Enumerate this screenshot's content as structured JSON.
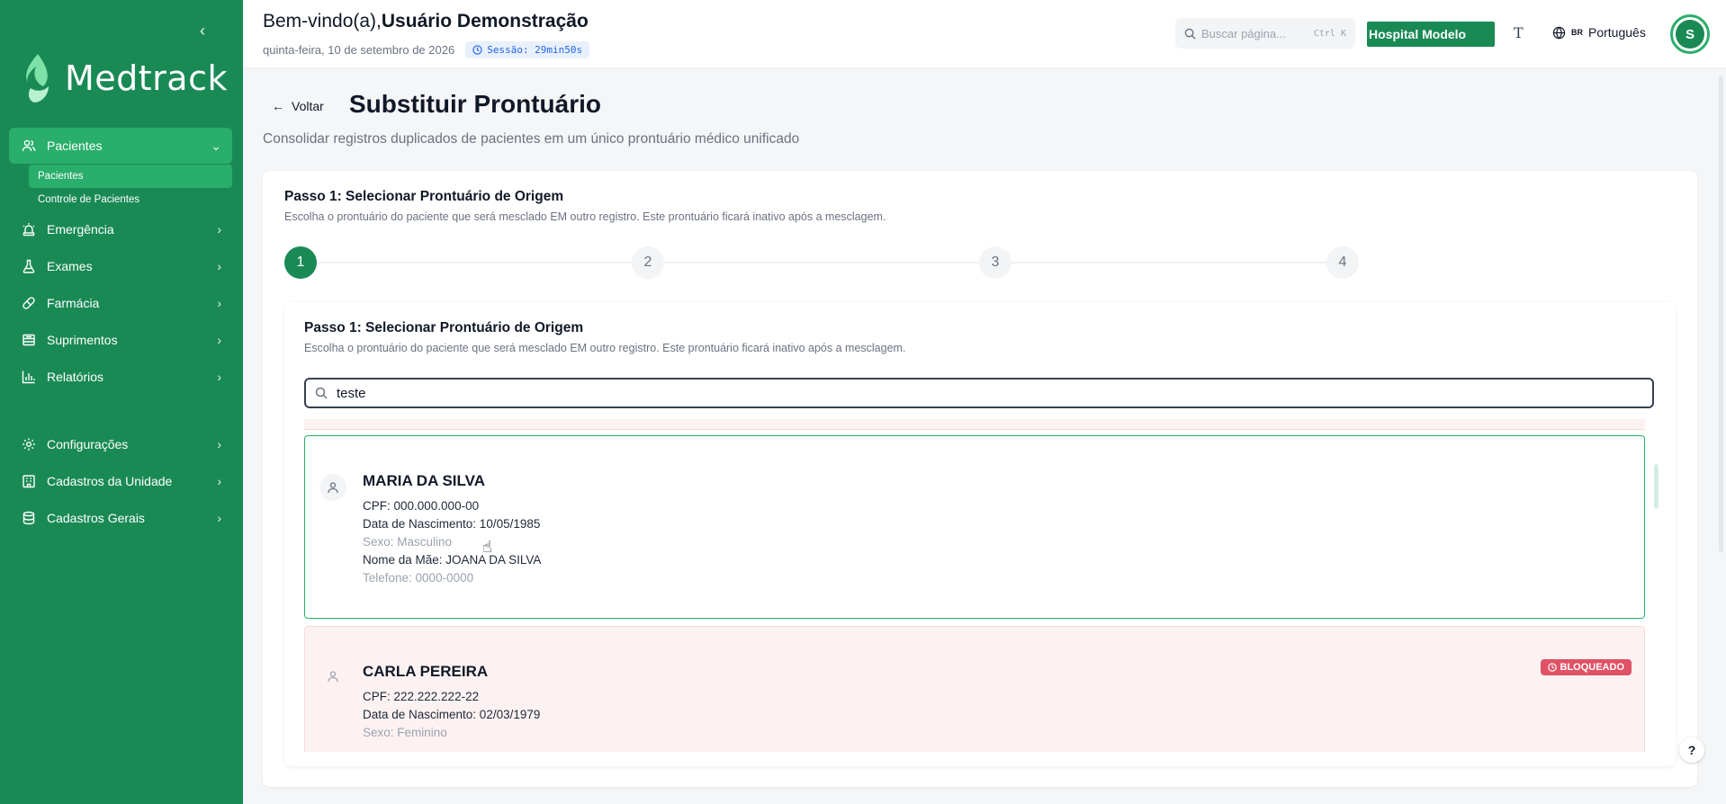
{
  "app": {
    "name": "Medtrack",
    "collapse_icon": "chevron-left-icon"
  },
  "sidebar": {
    "items": [
      {
        "label": "Pacientes",
        "icon": "users-icon",
        "active": true,
        "expanded": true,
        "children": [
          {
            "label": "Pacientes",
            "active": true
          },
          {
            "label": "Controle de Pacientes",
            "active": false
          }
        ]
      },
      {
        "label": "Emergência",
        "icon": "siren-icon"
      },
      {
        "label": "Exames",
        "icon": "flask-icon"
      },
      {
        "label": "Farmácia",
        "icon": "pill-icon"
      },
      {
        "label": "Suprimentos",
        "icon": "box-icon"
      },
      {
        "label": "Relatórios",
        "icon": "bar-chart-icon"
      }
    ],
    "bottom_items": [
      {
        "label": "Configurações",
        "icon": "gear-icon"
      },
      {
        "label": "Cadastros da Unidade",
        "icon": "building-icon"
      },
      {
        "label": "Cadastros Gerais",
        "icon": "database-icon"
      }
    ]
  },
  "header": {
    "welcome_prefix": "Bem-vindo(a),",
    "user_name": "Usuário Demonstração",
    "date": "quinta-feira, 10 de setembro de 2026",
    "session": "Sessão: 29min50s",
    "search_placeholder": "Buscar página...",
    "search_shortcut": "Ctrl K",
    "hospital": "Hospital Modelo",
    "font_toggle": "T",
    "language_flag": "BR",
    "language": "Português",
    "avatar_initial": "S"
  },
  "page": {
    "back_label": "Voltar",
    "title": "Substituir Prontuário",
    "subtitle": "Consolidar registros duplicados de pacientes em um único prontuário médico unificado"
  },
  "wizard": {
    "step_title": "Passo 1: Selecionar Prontuário de Origem",
    "step_desc": "Escolha o prontuário do paciente que será mesclado EM outro registro. Este prontuário ficará inativo após a mesclagem.",
    "steps": [
      "1",
      "2",
      "3",
      "4"
    ],
    "current_step": 1
  },
  "selector": {
    "title": "Passo 1: Selecionar Prontuário de Origem",
    "desc": "Escolha o prontuário do paciente que será mesclado EM outro registro. Este prontuário ficará inativo após a mesclagem.",
    "search_value": "teste",
    "patients": [
      {
        "name": "MARIA DA SILVA",
        "cpf": "CPF: 000.000.000-00",
        "birth": "Data de Nascimento: 10/05/1985",
        "sex": "Sexo: Masculino",
        "mother": "Nome da Mãe: JOANA DA SILVA",
        "phone": "Telefone: 0000-0000",
        "selected": true
      },
      {
        "name": "CARLA PEREIRA",
        "cpf": "CPF: 222.222.222-22",
        "birth": "Data de Nascimento: 02/03/1979",
        "sex": "Sexo: Feminino",
        "badge": "BLOQUEADO",
        "blocked": true
      }
    ]
  },
  "help": {
    "label": "?"
  },
  "colors": {
    "brand": "#1a8a55",
    "brand_active": "#2aae6b",
    "blocked_badge": "#e05266",
    "blocked_bg": "#fdf2f2"
  }
}
